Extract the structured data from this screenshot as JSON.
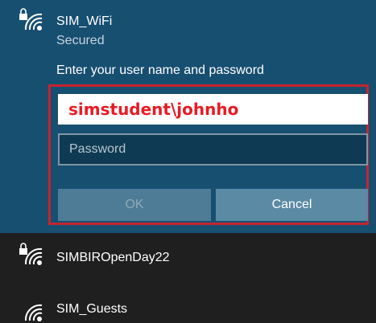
{
  "network_selected": {
    "name": "SIM_WiFi",
    "status": "Secured",
    "icon": "secured-wifi-icon"
  },
  "login_form": {
    "prompt": "Enter your user name and password",
    "username_value": "simstudent\\johnho",
    "password_placeholder": "Password",
    "ok_label": "OK",
    "cancel_label": "Cancel"
  },
  "other_networks": [
    {
      "name": "SIMBIROpenDay22",
      "icon": "secured-wifi-icon"
    },
    {
      "name": "SIM_Guests",
      "icon": "wifi-icon"
    }
  ],
  "colors": {
    "panel_bg": "#174f71",
    "list_bg": "#1f1f1f",
    "highlight_border": "#c6242f",
    "username_text": "#e81b24"
  }
}
